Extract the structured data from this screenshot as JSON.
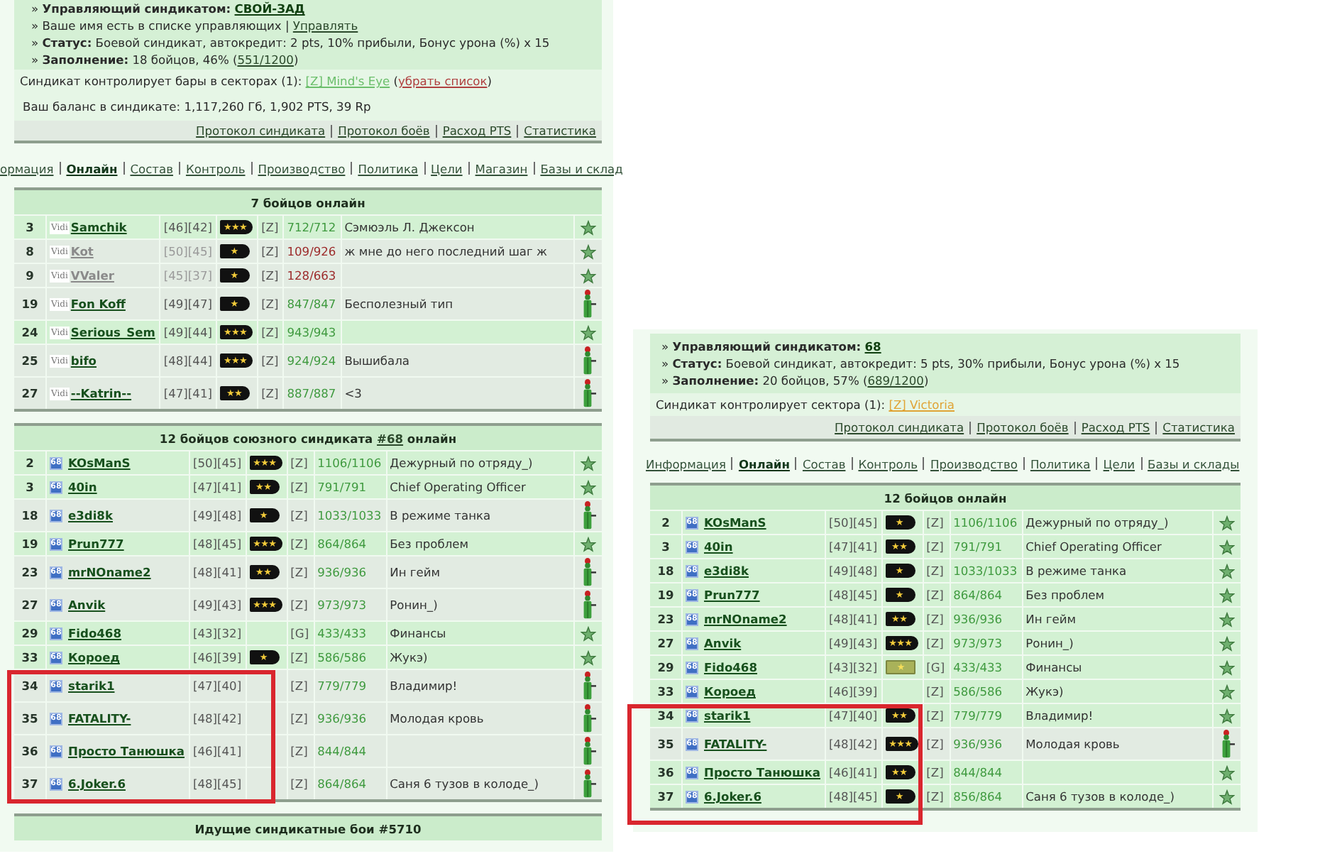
{
  "panels": [
    {
      "info_lines": [
        [
          {
            "kind": "text",
            "text": "» **Управляющий синдикатом:** "
          },
          {
            "kind": "bold_link",
            "text": "СВОЙ-ЗАД"
          }
        ],
        [
          {
            "kind": "text",
            "text": "» Ваше имя есть в списке управляющих | "
          },
          {
            "kind": "link",
            "text": "Управлять"
          }
        ],
        [
          {
            "kind": "text",
            "text": "» **Статус:** Боевой синдикат, автокредит: 2 pts, 10% прибыли, Бонус урона (%) x 15"
          }
        ],
        [
          {
            "kind": "text",
            "text": "» **Заполнение:** 18 бойцов, 46% ("
          },
          {
            "kind": "link",
            "text": "551/1200"
          },
          {
            "kind": "text",
            "text": ")"
          }
        ]
      ],
      "sector_line": [
        {
          "kind": "text",
          "text": "Синдикат контролирует бары в секторах (1): "
        },
        {
          "kind": "sector",
          "text": "[Z] Mind's Eye",
          "color": "#6cbf6c"
        },
        {
          "kind": "text",
          "text": " ("
        },
        {
          "kind": "remove",
          "text": "убрать список"
        },
        {
          "kind": "text",
          "text": ")"
        }
      ],
      "balance": "Ваш баланс в синдикате: 1,117,260 Гб, 1,902 PTS, 39 Rp",
      "links": [
        "Протокол синдиката",
        "Протокол боёв",
        "Расход PTS",
        "Статистика"
      ],
      "nav": [
        {
          "label": "ормация",
          "selected": false
        },
        {
          "label": "Онлайн",
          "selected": true
        },
        {
          "label": "Состав",
          "selected": false
        },
        {
          "label": "Контроль",
          "selected": false
        },
        {
          "label": "Производство",
          "selected": false
        },
        {
          "label": "Политика",
          "selected": false
        },
        {
          "label": "Цели",
          "selected": false
        },
        {
          "label": "Магазин",
          "selected": false
        },
        {
          "label": "Базы и склад",
          "selected": false
        }
      ],
      "tables": [
        {
          "title": [
            {
              "kind": "text",
              "text": "7 бойцов онлайн"
            }
          ],
          "rows": [
            {
              "num": "3",
              "emblem": {
                "kind": "plain",
                "text": "Vidi"
              },
              "name": "Samchik",
              "levels": "[46][42]",
              "badge": {
                "kind": "black",
                "label": "★★★"
              },
              "zone": "[Z]",
              "hp": "712/712",
              "note": "Сэмюэль Л. Джексон",
              "kind": "star",
              "shaded": false,
              "low_hp": false,
              "highlighted": false
            },
            {
              "num": "8",
              "emblem": {
                "kind": "plain",
                "text": "Vidi"
              },
              "name": "Kot",
              "levels": "[50][45]",
              "badge": {
                "kind": "black",
                "label": "★"
              },
              "zone": "[Z]",
              "hp": "109/926",
              "note": "ж мне до него последний шаг ж",
              "kind": "star",
              "shaded": true,
              "low_hp": true,
              "highlighted": false
            },
            {
              "num": "9",
              "emblem": {
                "kind": "plain",
                "text": "Vidi"
              },
              "name": "VValer",
              "levels": "[45][37]",
              "badge": {
                "kind": "black",
                "label": "★"
              },
              "zone": "[Z]",
              "hp": "128/663",
              "kind": "star",
              "shaded": true,
              "low_hp": true,
              "highlighted": false
            },
            {
              "num": "19",
              "emblem": {
                "kind": "plain",
                "text": "Vidi"
              },
              "name": "Fon Koff",
              "levels": "[49][47]",
              "badge": {
                "kind": "black",
                "label": "★"
              },
              "zone": "[Z]",
              "hp": "847/847",
              "note": "Бесполезный тип",
              "kind": "figure",
              "shaded": true,
              "low_hp": false,
              "highlighted": false
            },
            {
              "num": "24",
              "emblem": {
                "kind": "plain",
                "text": "Vidi"
              },
              "name": "Serious_Sem",
              "levels": "[49][44]",
              "badge": {
                "kind": "black",
                "label": "★★★"
              },
              "zone": "[Z]",
              "hp": "943/943",
              "kind": "star",
              "shaded": false,
              "low_hp": false,
              "highlighted": false
            },
            {
              "num": "25",
              "emblem": {
                "kind": "plain",
                "text": "Vidi"
              },
              "name": "bifo",
              "levels": "[48][44]",
              "badge": {
                "kind": "black",
                "label": "★★★"
              },
              "zone": "[Z]",
              "hp": "924/924",
              "note": "Вышибала",
              "kind": "figure",
              "shaded": true,
              "low_hp": false,
              "highlighted": false
            },
            {
              "num": "27",
              "emblem": {
                "kind": "plain",
                "text": "Vidi"
              },
              "name": "--Katrin--",
              "levels": "[47][41]",
              "badge": {
                "kind": "black",
                "label": "★★"
              },
              "zone": "[Z]",
              "hp": "887/887",
              "note": "<3",
              "kind": "figure",
              "shaded": true,
              "low_hp": false,
              "highlighted": false
            }
          ]
        },
        {
          "title": [
            {
              "kind": "text",
              "text": "12 бойцов союзного синдиката "
            },
            {
              "kind": "link",
              "text": "#68"
            },
            {
              "kind": "text",
              "text": " онлайн"
            }
          ],
          "rows": [
            {
              "num": "2",
              "emblem": {
                "kind": "square",
                "text": "68"
              },
              "name": "KOsManS",
              "levels": "[50][45]",
              "badge": {
                "kind": "black",
                "label": "★★★"
              },
              "zone": "[Z]",
              "hp": "1106/1106",
              "note": "Дежурный по отряду_)",
              "kind": "star",
              "shaded": false,
              "low_hp": false,
              "highlighted": false
            },
            {
              "num": "3",
              "emblem": {
                "kind": "square",
                "text": "68"
              },
              "name": "40in",
              "levels": "[47][41]",
              "badge": {
                "kind": "black",
                "label": "★★"
              },
              "zone": "[Z]",
              "hp": "791/791",
              "note": "Chief Operating Officer",
              "kind": "star",
              "shaded": false,
              "low_hp": false,
              "highlighted": false
            },
            {
              "num": "18",
              "emblem": {
                "kind": "square",
                "text": "68"
              },
              "name": "e3di8k",
              "levels": "[49][48]",
              "badge": {
                "kind": "black",
                "label": "★"
              },
              "zone": "[Z]",
              "hp": "1033/1033",
              "note": "В режиме танка",
              "kind": "figure",
              "shaded": true,
              "low_hp": false,
              "highlighted": false
            },
            {
              "num": "19",
              "emblem": {
                "kind": "square",
                "text": "68"
              },
              "name": "Prun777",
              "levels": "[48][45]",
              "badge": {
                "kind": "black",
                "label": "★★★"
              },
              "zone": "[Z]",
              "hp": "864/864",
              "note": "Без проблем",
              "kind": "star",
              "shaded": false,
              "low_hp": false,
              "highlighted": false
            },
            {
              "num": "23",
              "emblem": {
                "kind": "square",
                "text": "68"
              },
              "name": "mrNOname2",
              "levels": "[48][41]",
              "badge": {
                "kind": "black",
                "label": "★★"
              },
              "zone": "[Z]",
              "hp": "936/936",
              "note": "Ин гейм",
              "kind": "figure",
              "shaded": true,
              "low_hp": false,
              "highlighted": false
            },
            {
              "num": "27",
              "emblem": {
                "kind": "square",
                "text": "68"
              },
              "name": "Anvik",
              "levels": "[49][43]",
              "badge": {
                "kind": "black",
                "label": "★★★"
              },
              "zone": "[Z]",
              "hp": "973/973",
              "note": "Ронин_)",
              "kind": "figure",
              "shaded": true,
              "low_hp": false,
              "highlighted": false
            },
            {
              "num": "29",
              "emblem": {
                "kind": "square",
                "text": "68"
              },
              "name": "Fido468",
              "levels": "[43][32]",
              "zone": "[G]",
              "hp": "433/433",
              "note": "Финансы",
              "kind": "star",
              "shaded": false,
              "low_hp": false,
              "highlighted": false
            },
            {
              "num": "33",
              "emblem": {
                "kind": "square",
                "text": "68"
              },
              "name": "Короед",
              "levels": "[46][39]",
              "badge": {
                "kind": "black",
                "label": "★"
              },
              "zone": "[Z]",
              "hp": "586/586",
              "note": "Жукэ)",
              "kind": "star",
              "shaded": false,
              "low_hp": false,
              "highlighted": false
            },
            {
              "num": "34",
              "emblem": {
                "kind": "square",
                "text": "68"
              },
              "name": "starik1",
              "levels": "[47][40]",
              "zone": "[Z]",
              "hp": "779/779",
              "note": "Владимир!",
              "kind": "figure",
              "shaded": true,
              "low_hp": false,
              "highlighted": true
            },
            {
              "num": "35",
              "emblem": {
                "kind": "square",
                "text": "68"
              },
              "name": "FATALITY-",
              "levels": "[48][42]",
              "zone": "[Z]",
              "hp": "936/936",
              "note": "Молодая кровь",
              "kind": "figure",
              "shaded": true,
              "low_hp": false,
              "highlighted": true
            },
            {
              "num": "36",
              "emblem": {
                "kind": "square",
                "text": "68"
              },
              "name": "Просто Танюшка",
              "levels": "[46][41]",
              "zone": "[Z]",
              "hp": "844/844",
              "kind": "figure",
              "shaded": true,
              "low_hp": false,
              "highlighted": true
            },
            {
              "num": "37",
              "emblem": {
                "kind": "square",
                "text": "68"
              },
              "name": "6.Joker.6",
              "levels": "[48][45]",
              "zone": "[Z]",
              "hp": "864/864",
              "note": "Саня 6 тузов в колоде_)",
              "kind": "figure",
              "shaded": true,
              "low_hp": false,
              "highlighted": true
            }
          ]
        },
        {
          "title": [
            {
              "kind": "text",
              "text": "Идущие синдикатные бои #5710"
            }
          ]
        }
      ]
    },
    {
      "info_lines": [
        [
          {
            "kind": "text",
            "text": "» **Управляющий синдикатом:** "
          },
          {
            "kind": "bold_link",
            "text": "68"
          }
        ],
        [
          {
            "kind": "text",
            "text": "» **Статус:** Боевой синдикат, автокредит: 5 pts, 30% прибыли, Бонус урона (%) x 15"
          }
        ],
        [
          {
            "kind": "text",
            "text": "» **Заполнение:** 20 бойцов, 57% ("
          },
          {
            "kind": "link",
            "text": "689/1200"
          },
          {
            "kind": "text",
            "text": ")"
          }
        ]
      ],
      "sector_line": [
        {
          "kind": "text",
          "text": "Синдикат контролирует сектора (1): "
        },
        {
          "kind": "sector",
          "text": "[Z] Victoria",
          "color": "#e0a437"
        }
      ],
      "links": [
        "Протокол синдиката",
        "Протокол боёв",
        "Расход PTS",
        "Статистика"
      ],
      "nav": [
        {
          "label": "Информация",
          "selected": false
        },
        {
          "label": "Онлайн",
          "selected": true
        },
        {
          "label": "Состав",
          "selected": false
        },
        {
          "label": "Контроль",
          "selected": false
        },
        {
          "label": "Производство",
          "selected": false
        },
        {
          "label": "Политика",
          "selected": false
        },
        {
          "label": "Цели",
          "selected": false
        },
        {
          "label": "Базы и склады",
          "selected": false
        }
      ],
      "tables": [
        {
          "title": [
            {
              "kind": "text",
              "text": "12 бойцов онлайн"
            }
          ],
          "rows": [
            {
              "num": "2",
              "emblem": {
                "kind": "square",
                "text": "68"
              },
              "name": "KOsManS",
              "levels": "[50][45]",
              "badge": {
                "kind": "black",
                "label": "★"
              },
              "zone": "[Z]",
              "hp": "1106/1106",
              "note": "Дежурный по отряду_)",
              "kind": "star",
              "shaded": false,
              "low_hp": false,
              "highlighted": false
            },
            {
              "num": "3",
              "emblem": {
                "kind": "square",
                "text": "68"
              },
              "name": "40in",
              "levels": "[47][41]",
              "badge": {
                "kind": "black",
                "label": "★★"
              },
              "zone": "[Z]",
              "hp": "791/791",
              "note": "Chief Operating Officer",
              "kind": "star",
              "shaded": false,
              "low_hp": false,
              "highlighted": false
            },
            {
              "num": "18",
              "emblem": {
                "kind": "square",
                "text": "68"
              },
              "name": "e3di8k",
              "levels": "[49][48]",
              "badge": {
                "kind": "black",
                "label": "★"
              },
              "zone": "[Z]",
              "hp": "1033/1033",
              "note": "В режиме танка",
              "kind": "star",
              "shaded": false,
              "low_hp": false,
              "highlighted": false
            },
            {
              "num": "19",
              "emblem": {
                "kind": "square",
                "text": "68"
              },
              "name": "Prun777",
              "levels": "[48][45]",
              "badge": {
                "kind": "black",
                "label": "★"
              },
              "zone": "[Z]",
              "hp": "864/864",
              "note": "Без проблем",
              "kind": "star",
              "shaded": false,
              "low_hp": false,
              "highlighted": false
            },
            {
              "num": "23",
              "emblem": {
                "kind": "square",
                "text": "68"
              },
              "name": "mrNOname2",
              "levels": "[48][41]",
              "badge": {
                "kind": "black",
                "label": "★★"
              },
              "zone": "[Z]",
              "hp": "936/936",
              "note": "Ин гейм",
              "kind": "star",
              "shaded": false,
              "low_hp": false,
              "highlighted": false
            },
            {
              "num": "27",
              "emblem": {
                "kind": "square",
                "text": "68"
              },
              "name": "Anvik",
              "levels": "[49][43]",
              "badge": {
                "kind": "black",
                "label": "★★★"
              },
              "zone": "[Z]",
              "hp": "973/973",
              "note": "Ронин_)",
              "kind": "star",
              "shaded": false,
              "low_hp": false,
              "highlighted": false
            },
            {
              "num": "29",
              "emblem": {
                "kind": "square",
                "text": "68"
              },
              "name": "Fido468",
              "levels": "[43][32]",
              "badge": {
                "kind": "olive",
                "label": "★"
              },
              "zone": "[G]",
              "hp": "433/433",
              "note": "Финансы",
              "kind": "star",
              "shaded": false,
              "low_hp": false,
              "highlighted": false
            },
            {
              "num": "33",
              "emblem": {
                "kind": "square",
                "text": "68"
              },
              "name": "Короед",
              "levels": "[46][39]",
              "zone": "[Z]",
              "hp": "586/586",
              "note": "Жукэ)",
              "kind": "star",
              "shaded": false,
              "low_hp": false,
              "highlighted": false
            },
            {
              "num": "34",
              "emblem": {
                "kind": "square",
                "text": "68"
              },
              "name": "starik1",
              "levels": "[47][40]",
              "badge": {
                "kind": "black",
                "label": "★★"
              },
              "zone": "[Z]",
              "hp": "779/779",
              "note": "Владимир!",
              "kind": "star",
              "shaded": false,
              "low_hp": false,
              "highlighted": true
            },
            {
              "num": "35",
              "emblem": {
                "kind": "square",
                "text": "68"
              },
              "name": "FATALITY-",
              "levels": "[48][42]",
              "badge": {
                "kind": "black",
                "label": "★★★"
              },
              "zone": "[Z]",
              "hp": "936/936",
              "note": "Молодая кровь",
              "kind": "figure",
              "shaded": true,
              "low_hp": false,
              "highlighted": true
            },
            {
              "num": "36",
              "emblem": {
                "kind": "square",
                "text": "68"
              },
              "name": "Просто Танюшка",
              "levels": "[46][41]",
              "badge": {
                "kind": "black",
                "label": "★★"
              },
              "zone": "[Z]",
              "hp": "844/844",
              "kind": "star",
              "shaded": false,
              "low_hp": false,
              "highlighted": true
            },
            {
              "num": "37",
              "emblem": {
                "kind": "square",
                "text": "68"
              },
              "name": "6.Joker.6",
              "levels": "[48][45]",
              "badge": {
                "kind": "black",
                "label": "★"
              },
              "zone": "[Z]",
              "hp": "856/864",
              "note": "Саня 6 тузов в колоде_)",
              "kind": "star",
              "shaded": false,
              "low_hp": false,
              "highlighted": true
            }
          ]
        }
      ]
    }
  ]
}
